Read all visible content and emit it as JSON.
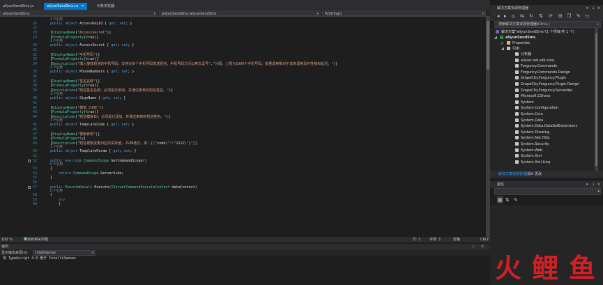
{
  "tabs": [
    {
      "label": "aliyunSendSms.js",
      "active": false
    },
    {
      "label": "aliyunSendSms.cs",
      "active": true,
      "close": "✕"
    },
    {
      "label": "对象浏览器",
      "active": false
    }
  ],
  "codebar": {
    "project": "aliyunSendSms",
    "class": "aliyunSendSms.aliyunSendSms",
    "member": "ToString()"
  },
  "code_lines": [
    {
      "n": "26",
      "ref": "1 个引用"
    },
    {
      "n": "26",
      "text": "public object AccessKeyId { get; set; }"
    },
    {
      "n": "27",
      "text": ""
    },
    {
      "n": "28",
      "text": "[DisplayName(\"AccessSecret\")]"
    },
    {
      "n": "29",
      "text": "[FormulaProperty(true)]",
      "ref": "1 个引用"
    },
    {
      "n": "30",
      "text": "public object AccessSecret { get; set; }"
    },
    {
      "n": "31",
      "text": ""
    },
    {
      "n": "32",
      "text": "[DisplayName(\"手机号码\")]"
    },
    {
      "n": "33",
      "text": "[FormulaProperty(true)]"
    },
    {
      "n": "34",
      "text": "[Description(\"填入接收短信的手机号码，支持对多个手机号码发送短信，手机号码之间以英文逗号\",\"分隔，上限为1000个手机号码。批量调用相对于单条调用及时性稍有延迟。\")]",
      "ref": "1 个引用"
    },
    {
      "n": "35",
      "text": "public object PhoneNumbers { get; set; }"
    },
    {
      "n": "36",
      "text": ""
    },
    {
      "n": "37",
      "text": "[DisplayName(\"签名名称\")]"
    },
    {
      "n": "38",
      "text": "[FormulaProperty(true)]"
    },
    {
      "n": "39",
      "text": "[Description(\"短信签名名称，必须是已添加、并通过审核的短信签名。\")]",
      "ref": "1 个引用"
    },
    {
      "n": "40",
      "text": "public object SignName { get; set; }"
    },
    {
      "n": "41",
      "text": ""
    },
    {
      "n": "42",
      "text": "[DisplayName(\"模板_CODE\")]"
    },
    {
      "n": "43",
      "text": "[FormulaProperty(true)]"
    },
    {
      "n": "44",
      "text": "[Description(\"短信模板ID，必须是已添加、并通过审核的短信签名。\")]",
      "ref": "1 个引用"
    },
    {
      "n": "45",
      "text": "public object TemplateCode { get; set; }"
    },
    {
      "n": "46",
      "text": ""
    },
    {
      "n": "47",
      "text": "[DisplayName(\"模板参数\")]"
    },
    {
      "n": "48",
      "text": "[FormulaProperty]"
    },
    {
      "n": "49",
      "text": "[Description(\"短信模板变量对应的实际值，JSON格式。如：{\\\"code\\\":\\\"1111\\\"}\")]",
      "ref": "1 个引用"
    },
    {
      "n": "50",
      "text": "public object TemplateParam { get; set; }"
    },
    {
      "n": "51",
      "text": ""
    },
    {
      "n": "52",
      "text": "public override CommandScope GetCommandScope()",
      "ref": "0 个引用",
      "fold": true
    },
    {
      "n": "53",
      "text": "{"
    },
    {
      "n": "54",
      "text": "    return CommandScope.ServerSide;"
    },
    {
      "n": "55",
      "text": "}"
    },
    {
      "n": "56",
      "text": ""
    },
    {
      "n": "57",
      "text": "public ExecuteResult Execute(IServerCommandExecuteContext dataContext)",
      "ref": "0 个引用",
      "fold": true
    },
    {
      "n": "58",
      "text": "{"
    },
    {
      "n": "59",
      "text": "    try"
    },
    {
      "n": "60",
      "text": "    {"
    }
  ],
  "editor_status": {
    "zoom": "100 %",
    "issues": "未找到相关问题",
    "line": "行: 1",
    "char": "字符: 1",
    "mode": "空格",
    "eol": "CRLF"
  },
  "output": {
    "title": "输出",
    "source_label": "显示输出来源(S):",
    "source_value": "IntelliSense",
    "lines": [
      "将 TypeScript 4.0 用于 IntelliSense>"
    ]
  },
  "solution_explorer": {
    "title": "解决方案资源管理器",
    "search_placeholder": "搜索解决方案资源管理器(Ctrl+;)",
    "solution": "解决方案\"aliyunSendSms\"(1 个项目/共 1 个)",
    "project": "aliyunSendSms",
    "properties": "Properties",
    "references": "引用",
    "items": [
      "分析器",
      "aliyun-net-sdk-core",
      "Forguncy.Commands",
      "Forguncy.Commands.Design",
      "GrapeCity.Forguncy.Plugin",
      "GrapeCity.Forguncy.Plugin.Design",
      "GrapeCity.Forguncy.ServerApi",
      "Microsoft.CSharp",
      "System",
      "System.Configuration",
      "System.Core",
      "System.Data",
      "System.Data.DataSetExtensions",
      "System.Drawing",
      "System.Net.Http",
      "System.Security",
      "System.Web",
      "System.Xml",
      "System.Xml.Linq"
    ],
    "bottom_tabs": [
      "解决方案资源管理器",
      "Git 更改"
    ]
  },
  "properties_panel": {
    "title": "属性"
  },
  "watermark": {
    "text": "火鲤鱼",
    "color": "#e21f26"
  },
  "colors": {
    "accent": "#007acc",
    "keyword": "#569cd6",
    "string": "#d69d85",
    "type": "#4ec9b0",
    "comment": "#57a64a"
  }
}
